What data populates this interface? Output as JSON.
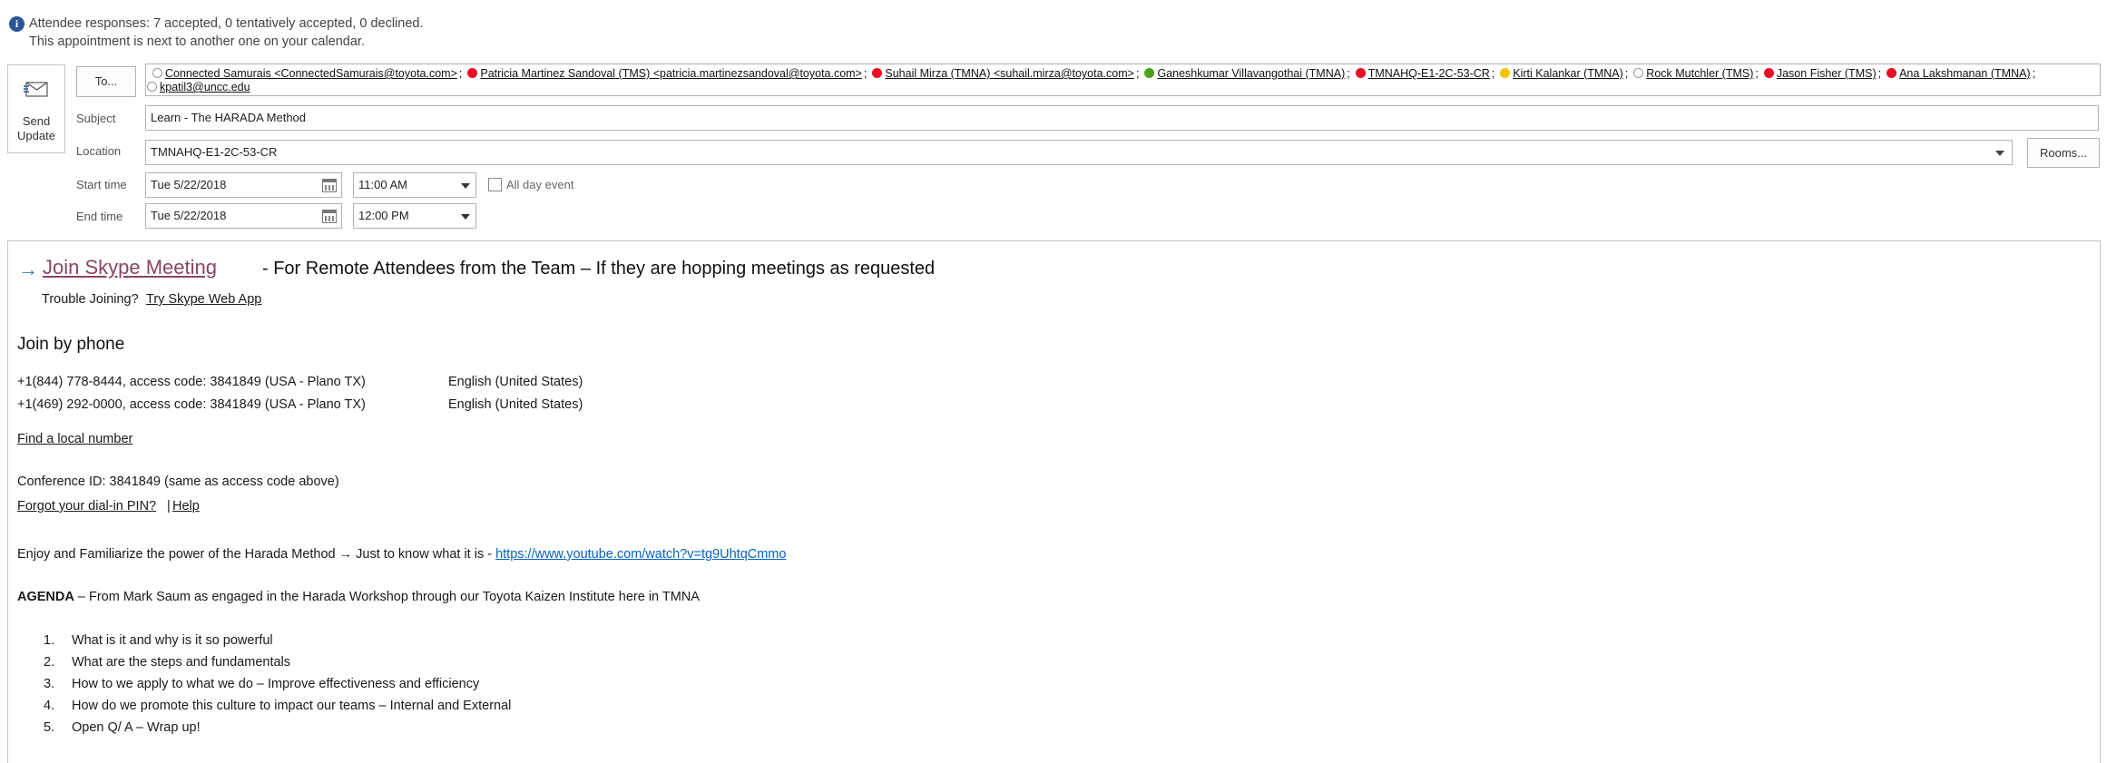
{
  "info": {
    "line1": "Attendee responses: 7 accepted, 0 tentatively accepted, 0 declined.",
    "line2": "This appointment is next to another one on your calendar."
  },
  "send_button": {
    "line1": "Send",
    "line2": "Update"
  },
  "to_button": "To...",
  "attendees_row1": [
    {
      "name": "Connected Samurais <ConnectedSamurais@toyota.com>",
      "status": "none"
    },
    {
      "name": "Patricia Martinez Sandoval (TMS) <patricia.martinezsandoval@toyota.com>",
      "status": "red"
    },
    {
      "name": "Suhail Mirza (TMNA) <suhail.mirza@toyota.com>",
      "status": "red"
    },
    {
      "name": "Ganeshkumar Villavangothai (TMNA)",
      "status": "green"
    },
    {
      "name": "TMNAHQ-E1-2C-53-CR",
      "status": "red"
    },
    {
      "name": "Kirti Kalankar (TMNA)",
      "status": "yellow"
    },
    {
      "name": "Rock Mutchler (TMS)",
      "status": "none"
    },
    {
      "name": "Jason Fisher (TMS)",
      "status": "red"
    },
    {
      "name": "Ana Lakshmanan (TMNA)",
      "status": "red"
    }
  ],
  "attendees_row2": [
    {
      "name": "kpatil3@uncc.edu",
      "status": "none"
    }
  ],
  "fields": {
    "subject_label": "Subject",
    "subject_value": "Learn - The HARADA Method",
    "location_label": "Location",
    "location_value": "TMNAHQ-E1-2C-53-CR",
    "rooms_button": "Rooms...",
    "start_label": "Start time",
    "start_date": "Tue 5/22/2018",
    "start_time": "11:00 AM",
    "all_day_label": "All day event",
    "end_label": "End time",
    "end_date": "Tue 5/22/2018",
    "end_time": "12:00 PM"
  },
  "body": {
    "arrow": "→",
    "join_skype": "Join Skype Meeting",
    "remote_note": "- For Remote Attendees from the Team – If they are hopping meetings as requested",
    "trouble": "Trouble Joining?",
    "web_app": "Try Skype Web App",
    "join_phone": "Join by phone",
    "phones": [
      {
        "number": "+1(844) 778-8444, access code: 3841849 (USA - Plano TX)",
        "language": "English (United States)"
      },
      {
        "number": "+1(469) 292-0000, access code: 3841849 (USA - Plano TX)",
        "language": "English (United States)"
      }
    ],
    "find_local": "Find a local number",
    "conference_id": "Conference ID: 3841849 (same as access code above)",
    "forgot_pin": "Forgot your dial-in PIN?",
    "pipe": "|",
    "help": "Help",
    "enjoy_text": "Enjoy and Familiarize the power of the Harada Method",
    "enjoy_arrow": "→",
    "enjoy_text2": "Just to know what it is -",
    "youtube": "https://www.youtube.com/watch?v=tg9UhtqCmmo",
    "agenda_bold": "AGENDA",
    "agenda_rest": "– From Mark Saum as engaged in the Harada Workshop through our Toyota Kaizen Institute here in TMNA",
    "agenda_items": [
      {
        "num": "1.",
        "text": "What is it and why is it so powerful"
      },
      {
        "num": "2.",
        "text": "What are the steps and fundamentals"
      },
      {
        "num": "3.",
        "text": "How to we apply to what we do – Improve effectiveness and efficiency"
      },
      {
        "num": "4.",
        "text": "How do we promote this culture to impact our teams – Internal and External"
      },
      {
        "num": "5.",
        "text": "Open Q/ A – Wrap up!"
      }
    ]
  }
}
